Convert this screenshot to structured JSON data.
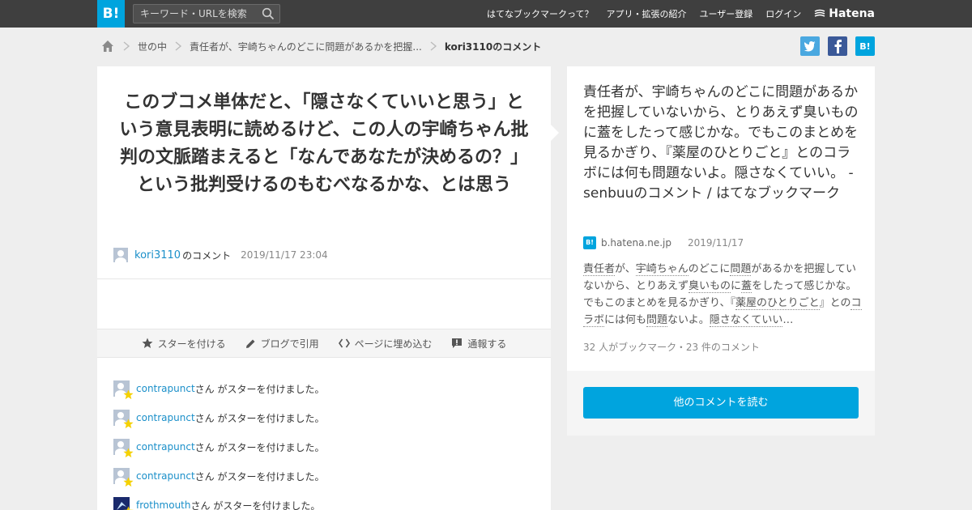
{
  "topbar": {
    "logo": "B!",
    "search_placeholder": "キーワード・URLを検索",
    "nav": [
      "はてなブックマークって？",
      "アプリ・拡張の紹介",
      "ユーザー登録",
      "ログイン"
    ],
    "brand": "Hatena"
  },
  "breadcrumb": {
    "items": [
      "世の中",
      "責任者が、宇崎ちゃんのどこに問題があるかを把握..."
    ],
    "current": "kori3110のコメント"
  },
  "share": {
    "twitter": "t",
    "facebook": "f",
    "hatena": "B!"
  },
  "comment": {
    "text": "このブコメ単体だと、「隠さなくていいと思う」という意見表明に読めるけど、この人の宇崎ちゃん批判の文脈踏まえると「なんであなたが決めるの？」という批判受けるのもむべなるかな、とは思う",
    "user": "kori3110",
    "suffix": "のコメント",
    "date": "2019/11/17 23:04"
  },
  "actions": [
    "スターを付ける",
    "ブログで引用",
    "ページに埋め込む",
    "通報する"
  ],
  "stars": [
    {
      "user": "contrapunct",
      "text": "さん がスターを付けました。"
    },
    {
      "user": "contrapunct",
      "text": "さん がスターを付けました。"
    },
    {
      "user": "contrapunct",
      "text": "さん がスターを付けました。"
    },
    {
      "user": "contrapunct",
      "text": "さん がスターを付けました。"
    },
    {
      "user": "frothmouth",
      "text": "さん がスターを付けました。"
    }
  ],
  "entry": {
    "title": "責任者が、宇崎ちゃんのどこに問題があるかを把握していないから、とりあえず臭いものに蓋をしたって感じかな。でもこのまとめを見るかぎり、『薬屋のひとりごと』とのコラボには何も問題ないよ。隠さなくていい。 - senbuuのコメント / はてなブックマーク",
    "favicon": "B!",
    "domain": "b.hatena.ne.jp",
    "date": "2019/11/17",
    "excerpt": [
      "責任者",
      "が、",
      "宇崎ちゃん",
      "のどこに",
      "問題",
      "があるかを把握していないから、とりあえず",
      "臭いもの",
      "に",
      "蓋",
      "をしたって感じかな。でもこのまとめを見るかぎり、『",
      "薬屋のひとりごと",
      "』との",
      "コラボ",
      "には何も",
      "問題",
      "ないよ。",
      "隠さなくていい",
      "…"
    ],
    "count": "32 人がブックマーク・23 件のコメント",
    "read_more": "他のコメントを読む"
  }
}
